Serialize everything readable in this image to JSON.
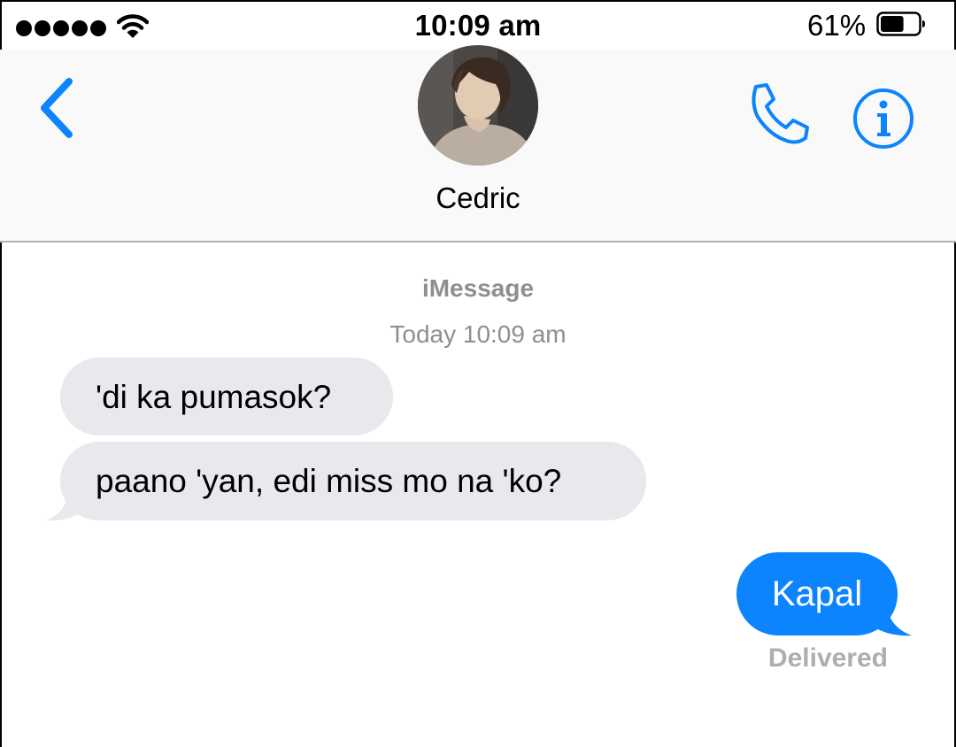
{
  "status_bar": {
    "time": "10:09 am",
    "battery_percent": "61%",
    "battery_level": 0.61,
    "signal_bars": 5
  },
  "header": {
    "contact_name": "Cedric",
    "back_icon": "chevron-left-icon",
    "call_icon": "phone-icon",
    "info_icon": "info-icon",
    "accent_color": "#0b84fe"
  },
  "conversation": {
    "service": "iMessage",
    "timestamp": "Today 10:09 am",
    "messages": [
      {
        "direction": "incoming",
        "text": "'di ka pumasok?"
      },
      {
        "direction": "incoming",
        "text": "paano 'yan, edi miss mo na 'ko?"
      },
      {
        "direction": "outgoing",
        "text": "Kapal"
      }
    ],
    "delivery_status": "Delivered"
  },
  "colors": {
    "incoming_bubble": "#e8e8ed",
    "outgoing_bubble": "#0b84fe",
    "meta_text": "#8e8e93"
  }
}
